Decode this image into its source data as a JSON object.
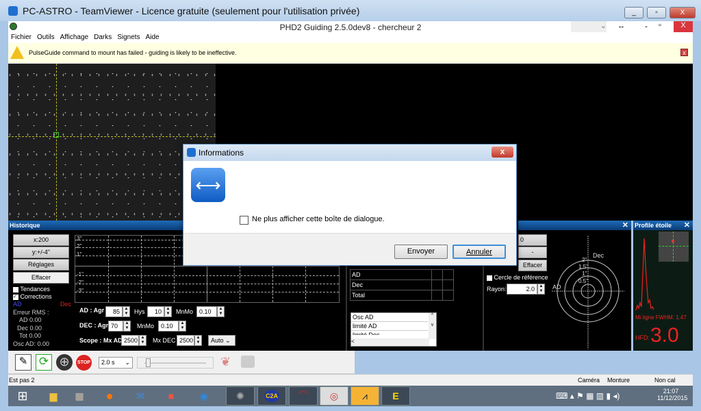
{
  "teamviewer": {
    "title": "PC-ASTRO - TeamViewer - Licence gratuite (seulement pour l'utilisation privée)",
    "min": "_",
    "max": "▫",
    "close": "X"
  },
  "phd": {
    "title": "PHD2 Guiding 2.5.0dev8 - chercheur 2",
    "min": "-",
    "max": "▫",
    "close": "X"
  },
  "menu": [
    "Fichier",
    "Outils",
    "Affichage",
    "Darks",
    "Signets",
    "Aide"
  ],
  "warning": {
    "text": "PulseGuide command to mount has failed - guiding is likely to be ineffective.",
    "close": "x"
  },
  "history": {
    "title": "Historique",
    "x_scale": "x:200",
    "y_scale": "y:+/-4\"",
    "settings": "Réglages",
    "clear": "Effacer",
    "trends": "Tendances",
    "corrections": "Corrections",
    "trends_checked": false,
    "corrections_checked": true,
    "ra_label": "AD",
    "dec_label": "Dec",
    "rms_title": "Erreur RMS :",
    "rms_ra": "AD 0.00",
    "rms_dec": "Dec 0.00",
    "rms_tot": "Tot 0.00",
    "osc": "Osc AD: 0.00",
    "y_ticks": [
      "3\"",
      "2\"",
      "1\"",
      "-1\"",
      "-2\"",
      "-3\""
    ],
    "ra": {
      "label": "AD : Agr",
      "agr": "85",
      "hys_label": "Hys",
      "hys": "10",
      "mnmo_label": "MnMo",
      "mnmo": "0.10"
    },
    "dec": {
      "label": "DEC : Agr",
      "agr": "70",
      "mnmo_label": "MnMo",
      "mnmo": "0.10"
    },
    "scope": {
      "label": "Scope : Mx AD",
      "mxad": "2500",
      "mxdec_label": "Mx DEC",
      "mxdec": "2500",
      "mode": "Auto"
    },
    "ra_color": "#3a3aff",
    "dec_color": "#e02020"
  },
  "stats": {
    "rows": [
      "AD",
      "Dec",
      "Total"
    ],
    "list": [
      "Osc AD",
      "limité AD",
      "limité Dec"
    ]
  },
  "target": {
    "dropdown": "0",
    "minus": "-",
    "clear": "Effacer",
    "ref_circle": "Cercle de référence",
    "radius_label": "Rayon:",
    "radius": "2.0",
    "dec": "Dec",
    "ad": "AD",
    "rings": [
      "2\"",
      "1.5\"",
      "1\"",
      "0.5\""
    ]
  },
  "profile": {
    "title": "Profile étoile",
    "fwhm": "Mi ligne FWHM: 1.47",
    "hfd_label": "HFD:",
    "hfd": "3.0"
  },
  "toolbar": {
    "exposure": "2.0 s"
  },
  "status": {
    "left": "Est pas  2",
    "camera": "Caméra",
    "mount": "Monture",
    "cal": "Non cal"
  },
  "taskbar": {
    "time": "21:07",
    "date": "11/12/2015",
    "apps": [
      "C2A"
    ]
  },
  "dialog": {
    "title": "Informations",
    "checkbox": "Ne plus afficher cette boîte de dialogue.",
    "send": "Envoyer",
    "cancel": "Annuler",
    "close": "x"
  }
}
